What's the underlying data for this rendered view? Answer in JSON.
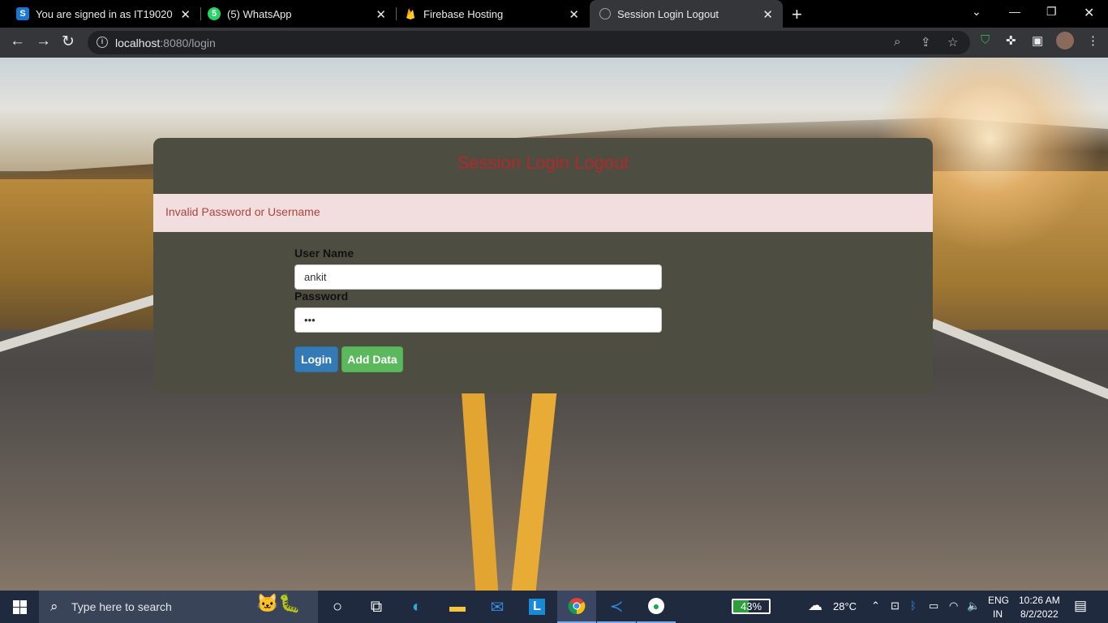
{
  "browser": {
    "tabs": [
      {
        "title": "You are signed in as IT19020",
        "favicon": "S",
        "favicon_color": "#1976d2"
      },
      {
        "title": "(5) WhatsApp",
        "favicon": "5",
        "favicon_color": "#25d366"
      },
      {
        "title": "Firebase Hosting",
        "favicon": "flame-icon",
        "favicon_color": "#ffa000"
      },
      {
        "title": "Session Login Logout",
        "favicon": "globe-icon",
        "favicon_color": "#9aa0a6"
      }
    ],
    "active_tab": 3,
    "url_host": "localhost",
    "url_rest": ":8080/login"
  },
  "page": {
    "title": "Session Login Logout",
    "alert": "Invalid Password or Username",
    "username_label": "User Name",
    "username_value": "ankit",
    "password_label": "Password",
    "password_value": "•••",
    "login_button": "Login",
    "add_button": "Add Data"
  },
  "taskbar": {
    "search_placeholder": "Type here to search",
    "battery": "43%",
    "battery_level": 0.43,
    "weather": "28°C",
    "lang": "ENG",
    "region": "IN",
    "time": "10:26 AM",
    "date": "8/2/2022"
  },
  "colors": {
    "title_red": "#b02a2a",
    "card": "#4d4d42",
    "alert_bg": "#f2dede",
    "login_blue": "#337ab7",
    "add_green": "#5cb85c"
  }
}
